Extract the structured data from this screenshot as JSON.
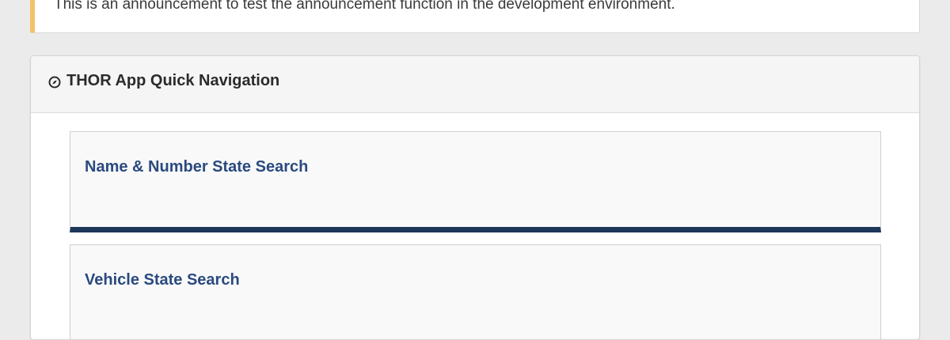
{
  "announcement": {
    "text": "This is an announcement to test the announcement function in the development environment.",
    "accent_color": "#f2c16b"
  },
  "quick_nav": {
    "title": "THOR App Quick Navigation",
    "icon": "compass-icon",
    "items": [
      {
        "label": "Name & Number State Search",
        "active": true
      },
      {
        "label": "Vehicle State Search",
        "active": false
      }
    ],
    "active_accent_color": "#1e3659",
    "link_color": "#2a4a7f"
  }
}
